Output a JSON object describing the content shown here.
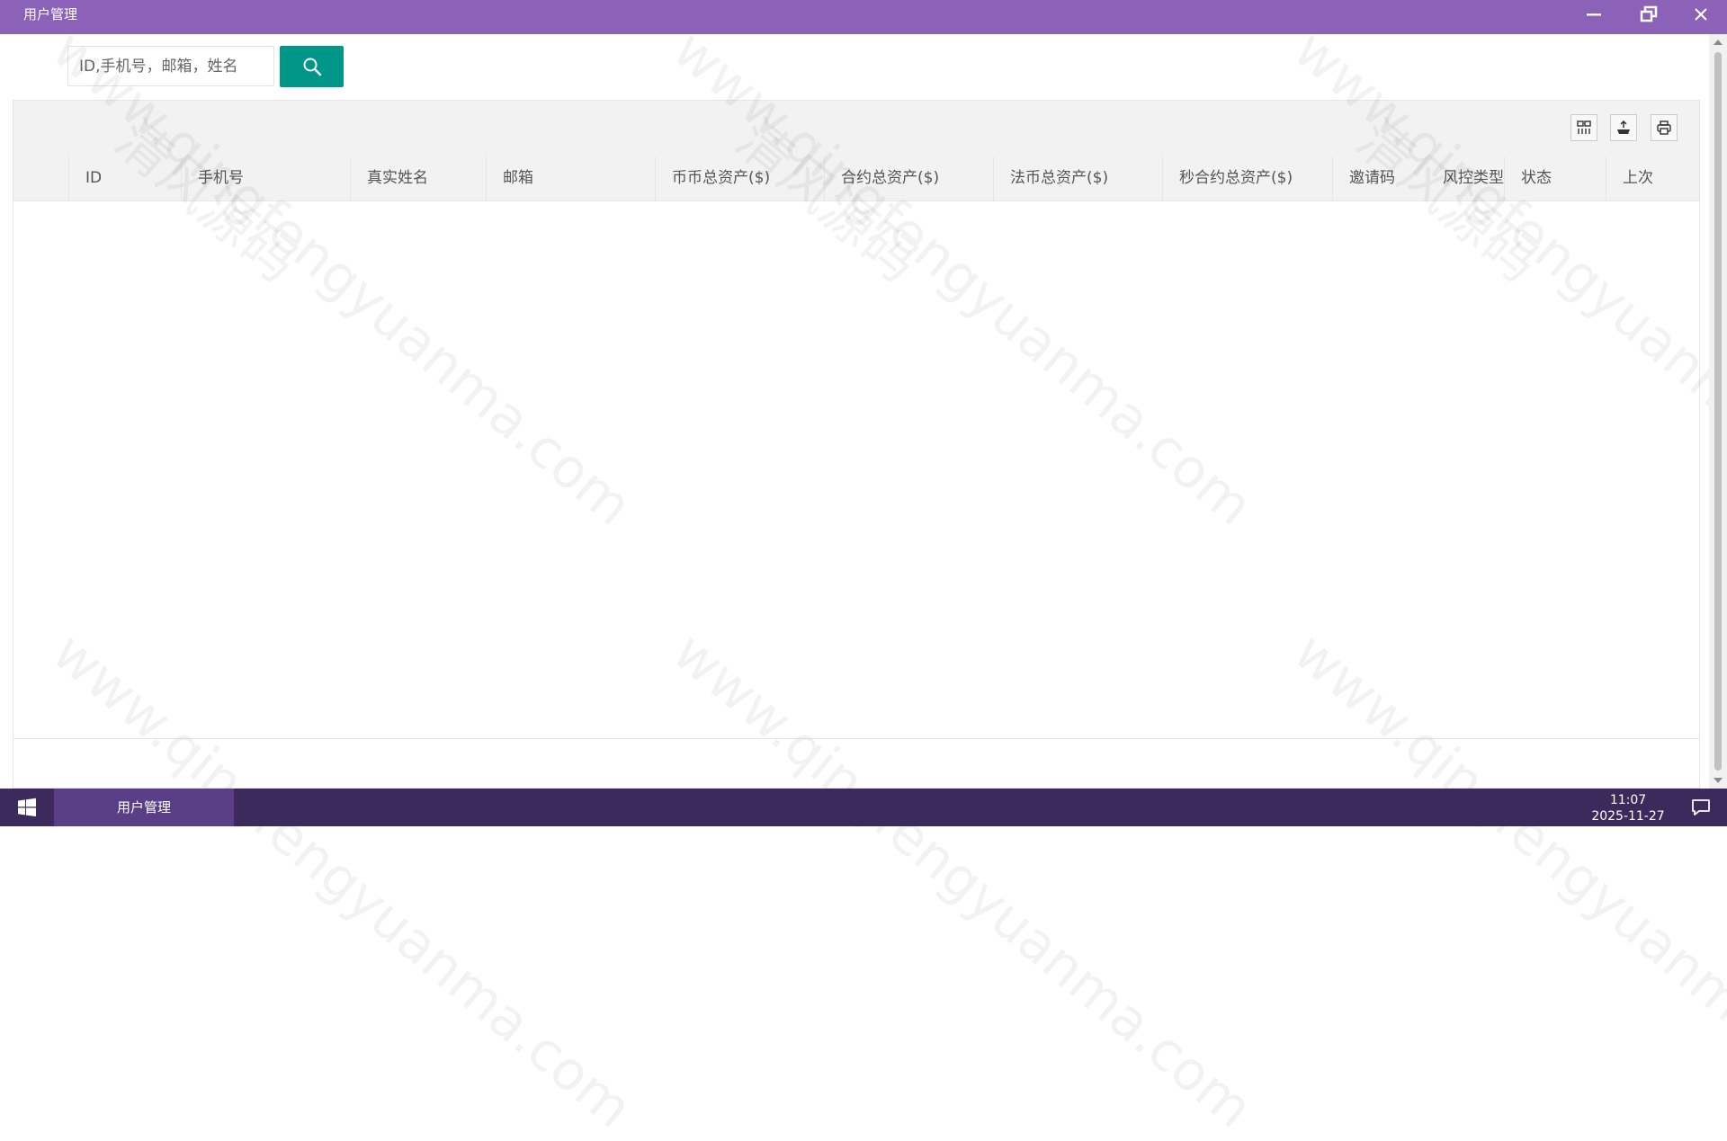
{
  "window": {
    "title": "用户管理"
  },
  "search": {
    "placeholder": "ID,手机号，邮箱，姓名",
    "value": ""
  },
  "table": {
    "columns": [
      "ID",
      "手机号",
      "真实姓名",
      "邮箱",
      "币币总资产($)",
      "合约总资产($)",
      "法币总资产($)",
      "秒合约总资产($)",
      "邀请码",
      "风控类型",
      "状态",
      "上次"
    ],
    "rows": []
  },
  "watermark": {
    "url": "www.qingfengyuanma.com",
    "text": "清风源码"
  },
  "taskbar": {
    "active_window": "用户管理",
    "time": "11:07",
    "date": "2025-11-27"
  },
  "colors": {
    "titlebar": "#8b62b8",
    "primary_button": "#009688",
    "taskbar": "#3d2a5c",
    "taskbar_active": "#5a3f87"
  },
  "icons": {
    "minimize": "minimize-icon",
    "restore": "restore-icon",
    "close": "close-icon",
    "search": "search-icon",
    "columns": "columns-icon",
    "export": "export-icon",
    "print": "print-icon",
    "start": "windows-logo-icon",
    "notifications": "chat-bubble-icon"
  }
}
